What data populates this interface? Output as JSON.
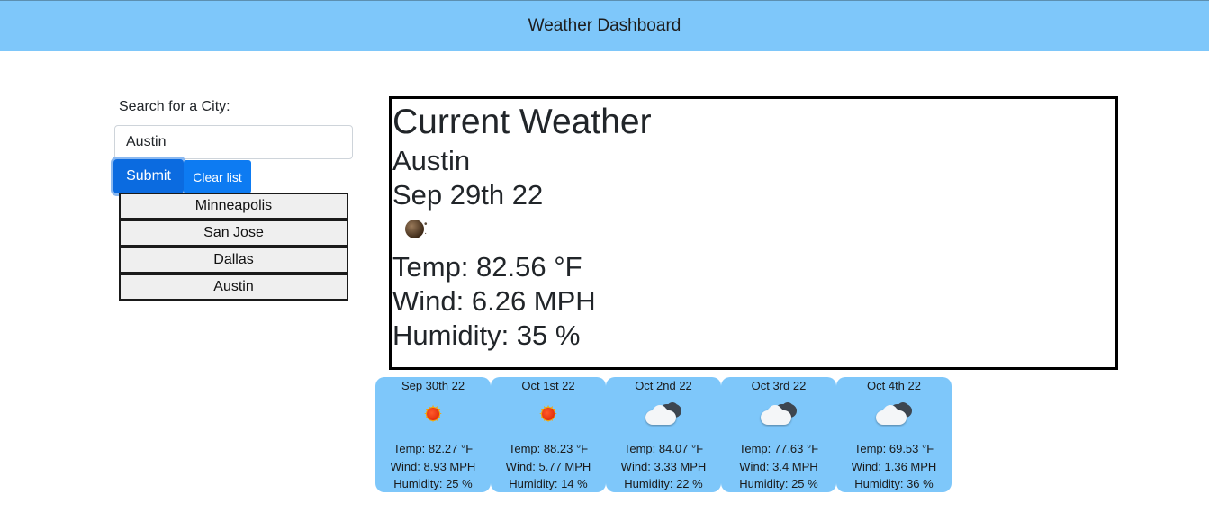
{
  "header": {
    "title": "Weather Dashboard"
  },
  "search": {
    "label": "Search for a City:",
    "value": "Austin",
    "submit_label": "Submit",
    "clear_label": "Clear list"
  },
  "history": [
    "Minneapolis",
    "San Jose",
    "Dallas",
    "Austin"
  ],
  "current": {
    "heading": "Current Weather",
    "city": "Austin",
    "date": "Sep 29th 22",
    "icon": "night-moon-icon",
    "temp": "Temp: 82.56 °F",
    "wind": "Wind: 6.26 MPH",
    "humidity": "Humidity: 35 %"
  },
  "forecast": [
    {
      "date": "Sep 30th 22",
      "icon": "sun-icon",
      "temp": "Temp: 82.27 °F",
      "wind": "Wind: 8.93 MPH",
      "humidity": "Humidity: 25 %"
    },
    {
      "date": "Oct 1st 22",
      "icon": "sun-icon",
      "temp": "Temp: 88.23 °F",
      "wind": "Wind: 5.77 MPH",
      "humidity": "Humidity: 14 %"
    },
    {
      "date": "Oct 2nd 22",
      "icon": "cloud-icon",
      "temp": "Temp: 84.07 °F",
      "wind": "Wind: 3.33 MPH",
      "humidity": "Humidity: 22 %"
    },
    {
      "date": "Oct 3rd 22",
      "icon": "cloud-icon",
      "temp": "Temp: 77.63 °F",
      "wind": "Wind: 3.4 MPH",
      "humidity": "Humidity: 25 %"
    },
    {
      "date": "Oct 4th 22",
      "icon": "cloud-icon",
      "temp": "Temp: 69.53 °F",
      "wind": "Wind: 1.36 MPH",
      "humidity": "Humidity: 36 %"
    }
  ],
  "colors": {
    "header_bg": "#7ec7fa",
    "card_bg": "#7ec7fa",
    "primary": "#0b6be0"
  }
}
